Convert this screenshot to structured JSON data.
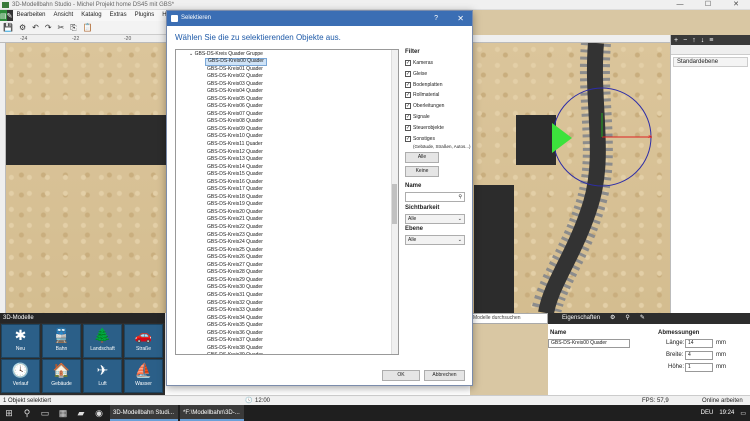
{
  "window": {
    "title": "3D-Modellbahn Studio - Michel Projekt home DS45 mit GBS*",
    "controls": [
      "—",
      "☐",
      "✕"
    ]
  },
  "menu": [
    "Bearbeiten",
    "Ansicht",
    "Katalog",
    "Extras",
    "Plugins",
    "Hilfe"
  ],
  "ruler": {
    "ticks": [
      "-24",
      "-22",
      "-20"
    ]
  },
  "right_panel": {
    "layer": "Standardebene"
  },
  "models_panel": {
    "title": "3D-Modelle",
    "tiles": [
      {
        "label": "Neu",
        "icon": "✱"
      },
      {
        "label": "Bahn",
        "icon": "🚆"
      },
      {
        "label": "Landschaft",
        "icon": "🌲"
      },
      {
        "label": "Straße",
        "icon": "🚗"
      },
      {
        "label": "Verlauf",
        "icon": "🕓"
      },
      {
        "label": "Gebäude",
        "icon": "🏠"
      },
      {
        "label": "Luft",
        "icon": "✈"
      },
      {
        "label": "Wasser",
        "icon": "⛵"
      }
    ]
  },
  "search": {
    "placeholder": "Modelle durchsuchen"
  },
  "properties": {
    "tab": "Eigenschaften",
    "name_label": "Name",
    "name_value": "GBS-DS-Kreis00 Quader",
    "dims_label": "Abmessungen",
    "length_label": "Länge:",
    "length_value": "14",
    "width_label": "Breite:",
    "width_value": "4",
    "height_label": "Höhe:",
    "height_value": "1",
    "unit": "mm"
  },
  "status": {
    "left": "1 Objekt selektiert",
    "time": "12:00",
    "fps": "FPS: 57,9",
    "online": "Online arbeiten"
  },
  "taskbar": {
    "task1": "3D-Modellbahn Studi...",
    "task2": "*F:\\Modellbahn\\3D-...",
    "lang": "DEU",
    "clock": "19:24"
  },
  "dialog": {
    "title": "Selektieren",
    "help": "?",
    "close": "✕",
    "heading": "Wählen Sie die zu selektierenden Objekte aus.",
    "tree_root": "GBS-DS-Kreis Quader Gruppe",
    "items": [
      "GBS-DS-Kreis00 Quader",
      "GBS-DS-Kreis01 Quader",
      "GBS-DS-Kreis02 Quader",
      "GBS-DS-Kreis03 Quader",
      "GBS-DS-Kreis04 Quader",
      "GBS-DS-Kreis05 Quader",
      "GBS-DS-Kreis06 Quader",
      "GBS-DS-Kreis07 Quader",
      "GBS-DS-Kreis08 Quader",
      "GBS-DS-Kreis09 Quader",
      "GBS-DS-Kreis10 Quader",
      "GBS-DS-Kreis11 Quader",
      "GBS-DS-Kreis12 Quader",
      "GBS-DS-Kreis13 Quader",
      "GBS-DS-Kreis14 Quader",
      "GBS-DS-Kreis15 Quader",
      "GBS-DS-Kreis16 Quader",
      "GBS-DS-Kreis17 Quader",
      "GBS-DS-Kreis18 Quader",
      "GBS-DS-Kreis19 Quader",
      "GBS-DS-Kreis20 Quader",
      "GBS-DS-Kreis21 Quader",
      "GBS-DS-Kreis22 Quader",
      "GBS-DS-Kreis23 Quader",
      "GBS-DS-Kreis24 Quader",
      "GBS-DS-Kreis25 Quader",
      "GBS-DS-Kreis26 Quader",
      "GBS-DS-Kreis27 Quader",
      "GBS-DS-Kreis28 Quader",
      "GBS-DS-Kreis29 Quader",
      "GBS-DS-Kreis30 Quader",
      "GBS-DS-Kreis31 Quader",
      "GBS-DS-Kreis32 Quader",
      "GBS-DS-Kreis33 Quader",
      "GBS-DS-Kreis34 Quader",
      "GBS-DS-Kreis35 Quader",
      "GBS-DS-Kreis36 Quader",
      "GBS-DS-Kreis37 Quader",
      "GBS-DS-Kreis38 Quader",
      "GBS-DS-Kreis39 Quader"
    ],
    "filter": {
      "title": "Filter",
      "options": [
        "Kameras",
        "Gleise",
        "Bodenplatten",
        "Rollmaterial",
        "Oberleitungen",
        "Signale",
        "Steuerobjekte",
        "Sonstiges"
      ],
      "sonstiges_note": "(Gebäude, Straßen, Autos...)",
      "all_button": "Alle",
      "none_button": "Keine",
      "name_label": "Name",
      "visibility_label": "Sichtbarkeit",
      "visibility_value": "Alle",
      "layer_label": "Ebene",
      "layer_value": "Alle"
    },
    "ok_button": "OK",
    "cancel_button": "Abbrechen"
  }
}
